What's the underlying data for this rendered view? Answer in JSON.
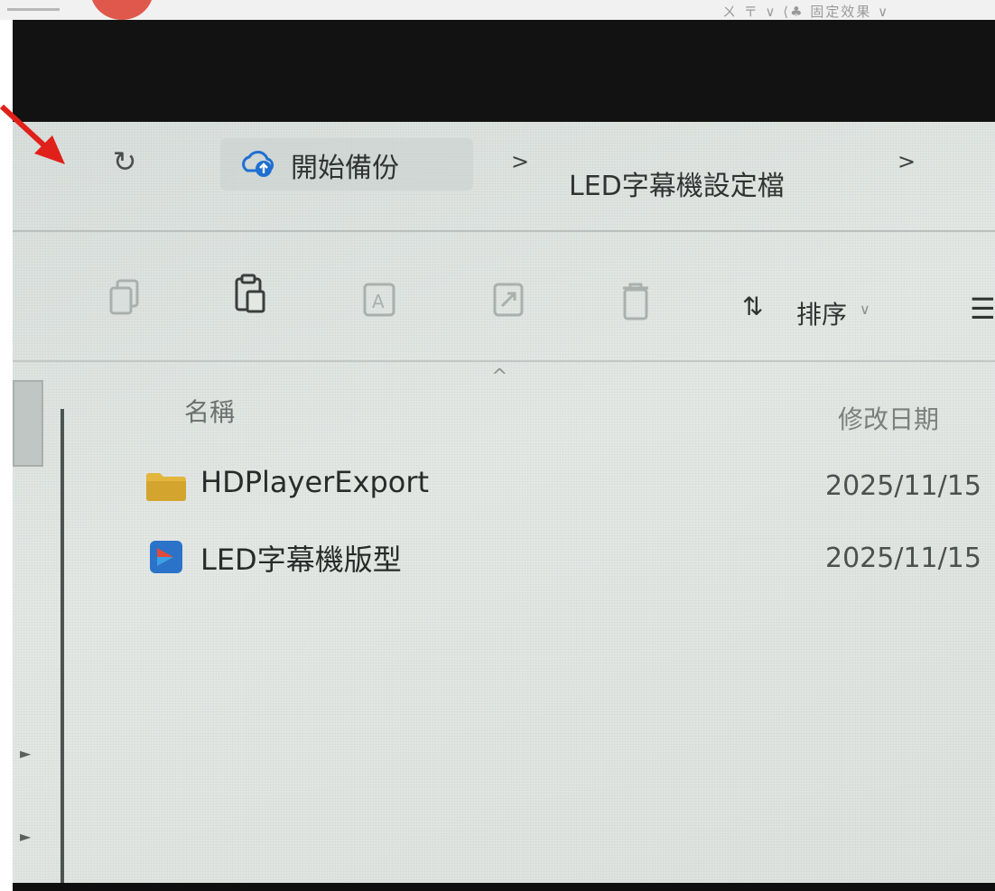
{
  "top_right_text": "ㄨ 〒 ∨  ⟨♣ 固定效果 ∨",
  "address_bar": {
    "breadcrumb": [
      "開始備份",
      "LED字幕機設定檔"
    ],
    "separator": ">"
  },
  "toolbar": {
    "icons": [
      "copy-icon",
      "paste-icon",
      "rename-icon",
      "share-icon",
      "delete-icon"
    ],
    "sort_label": "排序",
    "sort_chevron": "∨"
  },
  "file_list": {
    "columns": {
      "name": "名稱",
      "modified": "修改日期"
    },
    "rows": [
      {
        "name": "HDPlayerExport",
        "date": "2025/11/15",
        "icon": "folder-icon"
      },
      {
        "name": "LED字幕機版型",
        "date": "2025/11/15",
        "icon": "media-file-icon"
      }
    ]
  },
  "colors": {
    "folder": "#e3b63b",
    "media_file_blue": "#2a73c9",
    "media_file_red": "#e04a3a",
    "cloud_blue": "#1f6fd1",
    "annotation_red": "#e0201b"
  }
}
